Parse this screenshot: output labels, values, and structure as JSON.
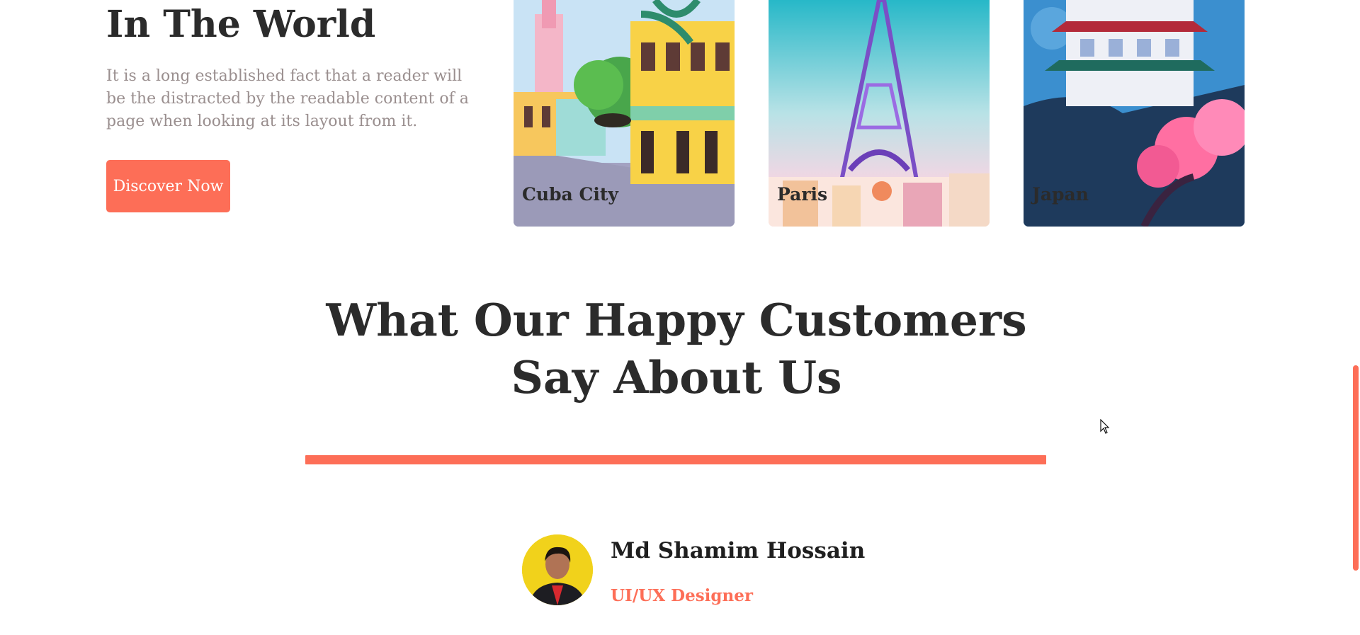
{
  "hero": {
    "title": "In The World",
    "text": "It is a long established fact that a reader will be the distracted by the readable content of a page when looking at its layout from it.",
    "button_label": "Discover Now"
  },
  "destinations": [
    {
      "name": "Cuba City"
    },
    {
      "name": "Paris"
    },
    {
      "name": "Japan"
    }
  ],
  "testimonials": {
    "title": "What Our Happy Customers Say About Us",
    "person": {
      "name": "Md Shamim Hossain",
      "role": "UI/UX Designer"
    }
  },
  "colors": {
    "accent": "#fd6e57",
    "heading": "#2b2b2b",
    "muted": "#9a8f8f"
  }
}
